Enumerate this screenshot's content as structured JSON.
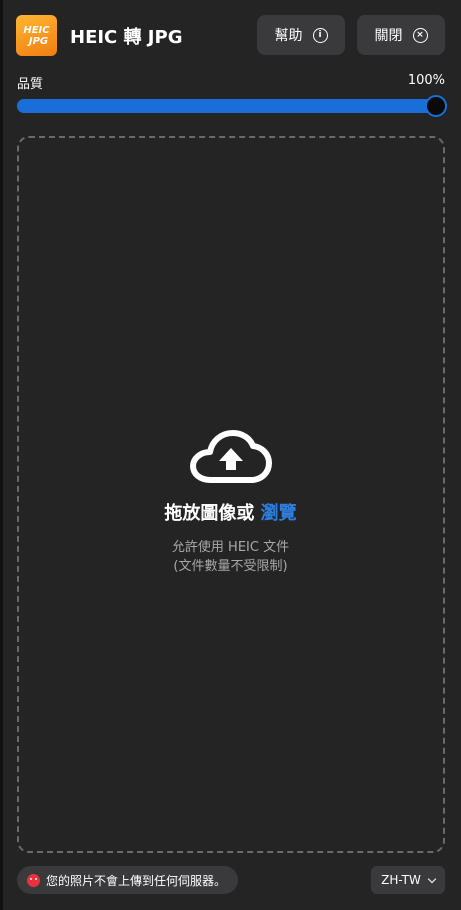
{
  "app": {
    "logo_line1": "HEIC",
    "logo_line2": "JPG",
    "title": "HEIC 轉 JPG"
  },
  "header": {
    "help_label": "幫助",
    "help_icon": "info-icon",
    "close_label": "關閉",
    "close_icon": "close-circle-icon"
  },
  "quality": {
    "label": "品質",
    "value_text": "100%",
    "value": 1.0
  },
  "dropzone": {
    "icon": "cloud-upload-icon",
    "title": "拖放圖像或",
    "browse_label": "瀏覽",
    "hint_line1": "允許使用 HEIC 文件",
    "hint_line2": "(文件數量不受限制)"
  },
  "footer": {
    "privacy_icon": "privacy-face-icon",
    "privacy_text": "您的照片不會上傳到任何伺服器。",
    "language": "ZH-TW"
  },
  "colors": {
    "background": "#242424",
    "accent": "#1a6ed8",
    "browse_link": "#2f7fe0",
    "button_bg": "#3a3a3c",
    "logo_orange": "#f7941d"
  }
}
